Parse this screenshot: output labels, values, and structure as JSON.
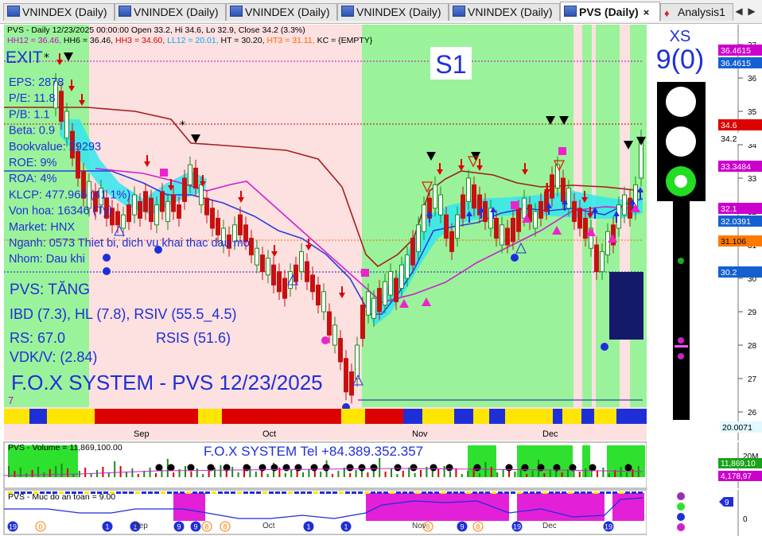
{
  "tabs": [
    {
      "label": "VNINDEX (Daily)",
      "active": false
    },
    {
      "label": "VNINDEX (Daily)",
      "active": false
    },
    {
      "label": "VNINDEX (Daily)",
      "active": false
    },
    {
      "label": "VNINDEX (Daily)",
      "active": false
    },
    {
      "label": "VNINDEX (Daily)",
      "active": false
    },
    {
      "label": "PVS (Daily)",
      "active": true
    },
    {
      "label": "Analysis1",
      "active": false
    }
  ],
  "tab_close": "×",
  "nav_prev": "◀",
  "nav_next": "▶",
  "header": {
    "line1": "PVS - Daily 12/23/2025 00:00:00 Open 33.2, Hi 34.6, Lo 32.9, Close 34.2 (3.3%)",
    "line2": [
      {
        "text": "HH12 = 36.46, ",
        "color": "#cc00cc"
      },
      {
        "text": "HH6 = 36.46, ",
        "color": "#000000"
      },
      {
        "text": "HH3 = 34.60, ",
        "color": "#cc0000"
      },
      {
        "text": "LL12 = 20.01, ",
        "color": "#00aaff"
      },
      {
        "text": "HT = 30.20, ",
        "color": "#000000"
      },
      {
        "text": "HT3 = 31.11, ",
        "color": "#ff6600"
      },
      {
        "text": "KC = {EMPTY}",
        "color": "#000000"
      }
    ]
  },
  "left_panel": {
    "exit": "EXIT",
    "fundamentals": [
      "EPS: 2878",
      "P/E: 11.8",
      "P/B: 1.1",
      "Beta: 0.9",
      "Bookvalue: 29293",
      "ROE: 9%",
      "ROA: 4%",
      "KLCP: 477.966 (41.1%)",
      "Von hoa: 16346 (Ty)",
      "Market: HNX",
      "Nganh: 0573 Thiet bi, dich vu khai thac dau mo",
      "Nhom: Dau khi"
    ],
    "status": "PVS: TĂNG",
    "ibd": "IBD (7.3), HL (7.8), RSIV (55.5_4.5)",
    "rs": "RS: 67.0",
    "rsis": "RSIS (51.6)",
    "vdk": "VDK/V:  (2.84)",
    "system": "F.O.X SYSTEM - PVS 12/23/2025",
    "bottom_num": "7"
  },
  "signal": {
    "label": "S1"
  },
  "xs": {
    "label": "XS",
    "value": "9(0)"
  },
  "price_axis": {
    "ticks": [
      "37",
      "36",
      "35",
      "34",
      "33",
      "32",
      "31",
      "30",
      "29",
      "28",
      "27",
      "26"
    ],
    "tags": [
      {
        "text": "36.4615",
        "bg": "#cc00cc",
        "fg": "#ffffff"
      },
      {
        "text": "36.4615",
        "bg": "#1560d0",
        "fg": "#ffffff"
      },
      {
        "text": "34.6",
        "bg": "#dd0000",
        "fg": "#ffffff"
      },
      {
        "text": "34.2",
        "bg": "#ffffff",
        "fg": "#000000"
      },
      {
        "text": "33.3484",
        "bg": "#cc00cc",
        "fg": "#ffffff"
      },
      {
        "text": "32.1",
        "bg": "#cc00cc",
        "fg": "#ffffff"
      },
      {
        "text": "32.0391",
        "bg": "#1560d0",
        "fg": "#ffffff"
      },
      {
        "text": "31.106",
        "bg": "#ff7a00",
        "fg": "#000000"
      },
      {
        "text": "30.2",
        "bg": "#1560d0",
        "fg": "#ffffff"
      },
      {
        "text": "20.0071",
        "bg": "#e0f8ff",
        "fg": "#000000"
      }
    ]
  },
  "months": [
    "Sep",
    "Oct",
    "Nov",
    "Dec"
  ],
  "volume": {
    "title": "PVS - Volume = 11,869,100.00",
    "contact": "F.O.X SYSTEM Tel +84.389.352.357",
    "axis_tick": "20M",
    "tags": [
      {
        "text": "11,869,10",
        "bg": "#19a319",
        "fg": "#ffffff"
      },
      {
        "text": "4,178,97",
        "bg": "#cc00cc",
        "fg": "#ffffff"
      }
    ]
  },
  "safety": {
    "title": "PVS - Muc do an toan = 9.00",
    "axis_tick": "0",
    "tag": "9",
    "badges": [
      "19",
      "0",
      "1",
      "1",
      "9",
      "9",
      "8",
      "8",
      "1",
      "1",
      "8",
      "9",
      "8",
      "19",
      "19"
    ]
  },
  "chart_data": {
    "type": "candlestick",
    "last": {
      "open": 33.2,
      "high": 34.6,
      "low": 32.9,
      "close": 34.2,
      "change_pct": 3.3
    },
    "levels": {
      "HH12": 36.46,
      "HH6": 36.46,
      "HH3": 34.6,
      "LL12": 20.01,
      "HT": 30.2,
      "HT3": 31.11
    },
    "ylim": [
      25.6,
      37.6
    ],
    "volume_last": 11869100,
    "safety_level": 9
  },
  "colors": {
    "bg_green": "#9af39a",
    "bg_pink": "#fde0e0",
    "up": "#1c8a1c",
    "down": "#c81010",
    "ma_red": "#a51c1c",
    "ma_blue": "#2a3fdc",
    "ma_magenta": "#cc22cc",
    "band_cyan": "#33e6ee"
  }
}
